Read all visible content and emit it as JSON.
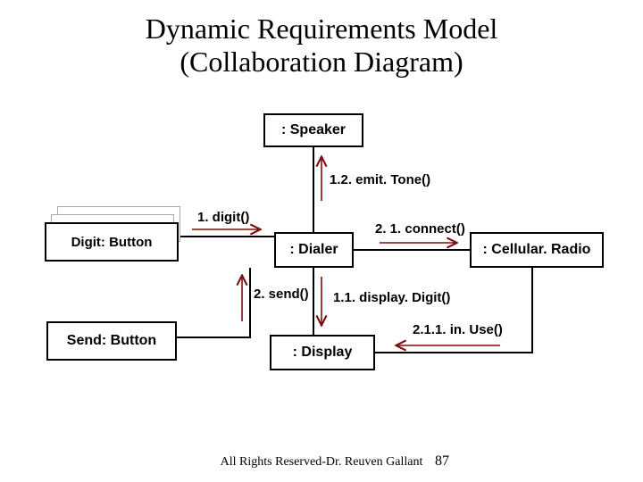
{
  "title_line1": "Dynamic Requirements Model",
  "title_line2": "(Collaboration Diagram)",
  "nodes": {
    "speaker": ": Speaker",
    "dialer": ": Dialer",
    "cellular_radio": ": Cellular. Radio",
    "display": ": Display",
    "digit_button": "Digit: Button",
    "send_button": "Send: Button"
  },
  "messages": {
    "emit_tone": "1.2. emit. Tone()",
    "digit": "1. digit()",
    "connect": "2. 1. connect()",
    "send": "2. send()",
    "display_digit": "1.1. display. Digit()",
    "in_use": "2.1.1. in. Use()"
  },
  "footer": "All Rights Reserved-Dr. Reuven Gallant",
  "page_number": "87",
  "diagram_data": {
    "type": "collaboration-diagram",
    "objects": [
      {
        "id": "speaker",
        "label": ": Speaker"
      },
      {
        "id": "dialer",
        "label": ": Dialer"
      },
      {
        "id": "cellular_radio",
        "label": ": Cellular. Radio"
      },
      {
        "id": "display",
        "label": ": Display"
      },
      {
        "id": "digit_button",
        "label": "Digit: Button",
        "multiplicity": "many"
      },
      {
        "id": "send_button",
        "label": "Send: Button"
      }
    ],
    "links": [
      {
        "from": "digit_button",
        "to": "dialer"
      },
      {
        "from": "send_button",
        "to": "dialer"
      },
      {
        "from": "dialer",
        "to": "speaker"
      },
      {
        "from": "dialer",
        "to": "display"
      },
      {
        "from": "dialer",
        "to": "cellular_radio"
      },
      {
        "from": "cellular_radio",
        "to": "display"
      }
    ],
    "messages": [
      {
        "seq": "1",
        "name": "digit()",
        "from": "digit_button",
        "to": "dialer"
      },
      {
        "seq": "1.1",
        "name": "display. Digit()",
        "from": "dialer",
        "to": "display"
      },
      {
        "seq": "1.2",
        "name": "emit. Tone()",
        "from": "dialer",
        "to": "speaker"
      },
      {
        "seq": "2",
        "name": "send()",
        "from": "send_button",
        "to": "dialer"
      },
      {
        "seq": "2.1",
        "name": "connect()",
        "from": "dialer",
        "to": "cellular_radio"
      },
      {
        "seq": "2.1.1",
        "name": "in. Use()",
        "from": "cellular_radio",
        "to": "display"
      }
    ]
  }
}
